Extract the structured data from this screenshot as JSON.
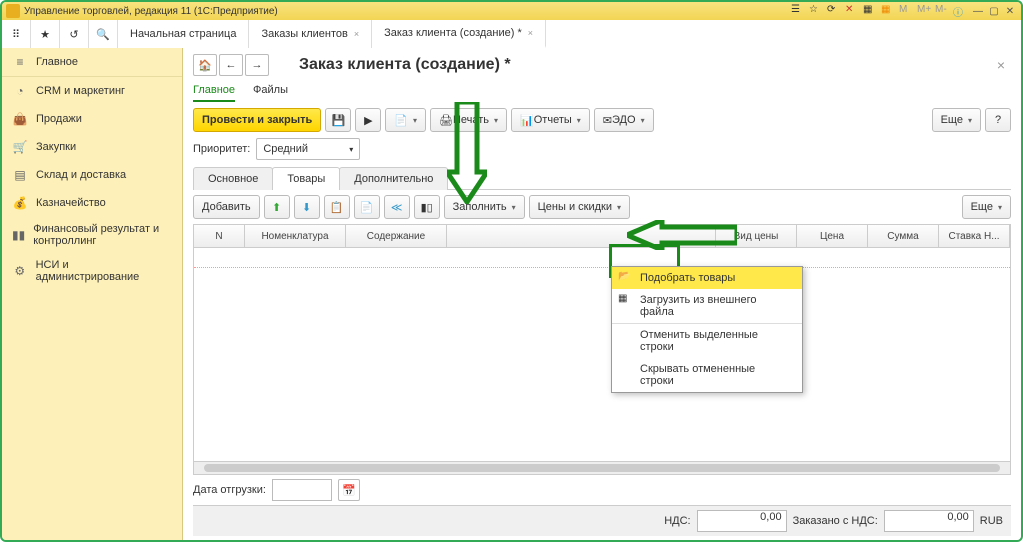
{
  "title": "Управление торговлей, редакция 11 (1С:Предприятие)",
  "tabs": {
    "t1": "Начальная страница",
    "t2": "Заказы клиентов",
    "t3": "Заказ клиента (создание) *"
  },
  "sidebar": [
    "Главное",
    "CRM и маркетинг",
    "Продажи",
    "Закупки",
    "Склад и доставка",
    "Казначейство",
    "Финансовый результат и контроллинг",
    "НСИ и администрирование"
  ],
  "page": {
    "title": "Заказ клиента (создание) *",
    "sub1": "Главное",
    "sub2": "Файлы"
  },
  "tb": {
    "post": "Провести и закрыть",
    "print": "Печать",
    "reports": "Отчеты",
    "edo": "ЭДО",
    "more": "Еще"
  },
  "prio": {
    "label": "Приоритет:",
    "value": "Средний"
  },
  "dtabs": {
    "t1": "Основное",
    "t2": "Товары",
    "t3": "Дополнительно"
  },
  "row": {
    "add": "Добавить",
    "fill": "Заполнить",
    "prices": "Цены и скидки",
    "more": "Еще"
  },
  "cols": {
    "c1": "N",
    "c2": "Номенклатура",
    "c3": "Содержание",
    "c4": "Вид цены",
    "c5": "Цена",
    "c6": "Сумма",
    "c7": "Ставка Н..."
  },
  "menu": {
    "m1": "Подобрать товары",
    "m2": "Загрузить из внешнего файла",
    "m3": "Отменить выделенные строки",
    "m4": "Скрывать отмененные строки"
  },
  "ship": "Дата отгрузки:",
  "bot": {
    "nds": "НДС:",
    "v1": "0,00",
    "inc": "Заказано с НДС:",
    "v2": "0,00",
    "cur": "RUB"
  }
}
